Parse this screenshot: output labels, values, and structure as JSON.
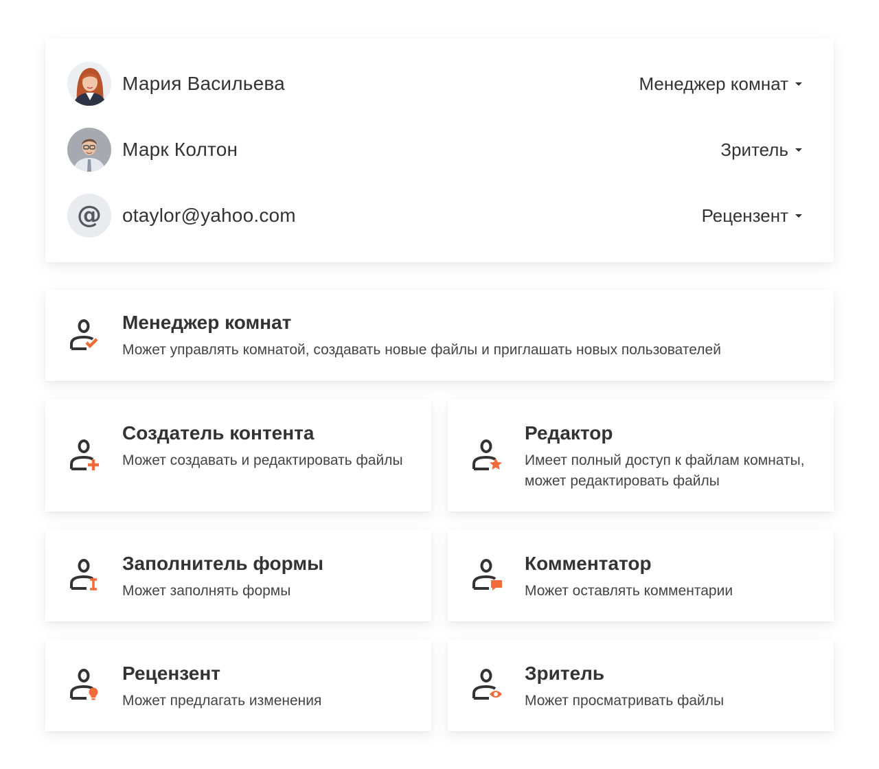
{
  "users": [
    {
      "name": "Мария Васильева",
      "role": "Менеджер комнат",
      "avatar": "female-user-photo"
    },
    {
      "name": "Марк Колтон",
      "role": "Зритель",
      "avatar": "male-user-photo"
    },
    {
      "name": "otaylor@yahoo.com",
      "role": "Рецензент",
      "avatar": "at-sign-icon",
      "avatar_glyph": "@"
    }
  ],
  "roles": {
    "manager": {
      "title": "Менеджер комнат",
      "description": "Может управлять комнатой, создавать новые файлы и приглашать новых пользователей",
      "icon": "user-check-icon"
    },
    "content_creator": {
      "title": "Создатель контента",
      "description": "Может создавать и редактировать файлы",
      "icon": "user-plus-icon"
    },
    "editor": {
      "title": "Редактор",
      "description": "Имеет полный доступ к файлам комнаты, может редактировать файлы",
      "icon": "user-star-icon"
    },
    "form_filler": {
      "title": "Заполнитель формы",
      "description": "Может заполнять формы",
      "icon": "user-text-cursor-icon"
    },
    "commentator": {
      "title": "Комментатор",
      "description": "Может оставлять комментарии",
      "icon": "user-comment-icon"
    },
    "reviewer": {
      "title": "Рецензент",
      "description": "Может предлагать изменения",
      "icon": "user-lightbulb-icon"
    },
    "viewer": {
      "title": "Зритель",
      "description": "Может просматривать файлы",
      "icon": "user-eye-icon"
    }
  },
  "colors": {
    "accent": "#f26b3a",
    "icon_dark": "#333333",
    "text": "#333333",
    "avatar_placeholder_bg": "#e9ebef"
  }
}
